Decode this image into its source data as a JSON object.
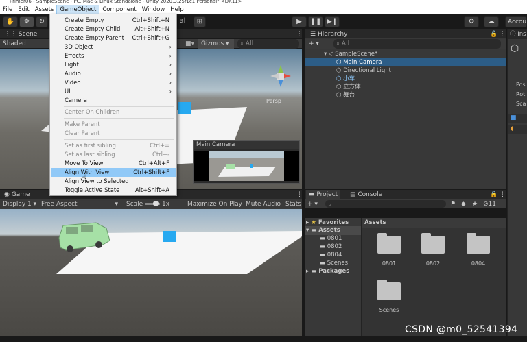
{
  "window": {
    "title": "Primer06 - SampleScene - PC, Mac & Linux Standalone - Unity 2020.3.25f1c1 Personal* <DX11>"
  },
  "menubar": {
    "items": [
      "File",
      "Edit",
      "Assets",
      "GameObject",
      "Component",
      "Window",
      "Help"
    ]
  },
  "toolbar": {
    "account_label": "Accou",
    "layout_partial": "al"
  },
  "scene_tab": {
    "label": "Scene",
    "shaded": "Shaded",
    "gizmos": "Gizmos",
    "search_placeholder": "All",
    "persp": "Persp"
  },
  "camera_preview": {
    "title": "Main Camera"
  },
  "game_tab": {
    "label": "Game",
    "display": "Display 1",
    "aspect": "Free Aspect",
    "scale_label": "Scale",
    "scale_value": "1x",
    "maximize": "Maximize On Play",
    "mute": "Mute Audio",
    "stats": "Stats"
  },
  "hierarchy": {
    "tab": "Hierarchy",
    "search_placeholder": "All",
    "scene_name": "SampleScene*",
    "items": [
      "Main Camera",
      "Directional Light",
      "小车",
      "立方体",
      "舞台"
    ]
  },
  "inspector": {
    "tab": "Ins",
    "rows": [
      "Pos",
      "Rot",
      "Sca"
    ]
  },
  "project": {
    "tab_project": "Project",
    "tab_console": "Console",
    "favorites": "Favorites",
    "assets_root": "Assets",
    "folders": [
      "0801",
      "0802",
      "0804",
      "Scenes"
    ],
    "packages": "Packages",
    "breadcrumb": "Assets",
    "grid_items": [
      "0801",
      "0802",
      "0804",
      "Scenes"
    ],
    "count_badge": "11"
  },
  "gameobject_menu": {
    "items": [
      {
        "label": "Create Empty",
        "shortcut": "Ctrl+Shift+N"
      },
      {
        "label": "Create Empty Child",
        "shortcut": "Alt+Shift+N"
      },
      {
        "label": "Create Empty Parent",
        "shortcut": "Ctrl+Shift+G"
      },
      {
        "label": "3D Object",
        "arrow": "›"
      },
      {
        "label": "Effects",
        "arrow": "›"
      },
      {
        "label": "Light",
        "arrow": "›"
      },
      {
        "label": "Audio",
        "arrow": "›"
      },
      {
        "label": "Video",
        "arrow": "›"
      },
      {
        "label": "UI",
        "arrow": "›"
      },
      {
        "label": "Camera"
      },
      {
        "label": "Center On Children"
      },
      {
        "label": "Make Parent"
      },
      {
        "label": "Clear Parent"
      },
      {
        "label": "Set as first sibling",
        "shortcut": "Ctrl+="
      },
      {
        "label": "Set as last sibling",
        "shortcut": "Ctrl+-"
      },
      {
        "label": "Move To View",
        "shortcut": "Ctrl+Alt+F"
      },
      {
        "label": "Align With View",
        "shortcut": "Ctrl+Shift+F"
      },
      {
        "label": "Align View to Selected"
      },
      {
        "label": "Toggle Active State",
        "shortcut": "Alt+Shift+A"
      }
    ]
  },
  "watermark": "CSDN @m0_52541394",
  "colors": {
    "highlight": "#91c9f7",
    "selection": "#2c5d87",
    "car": "#a6e0a6",
    "cube": "#27a9f0"
  }
}
